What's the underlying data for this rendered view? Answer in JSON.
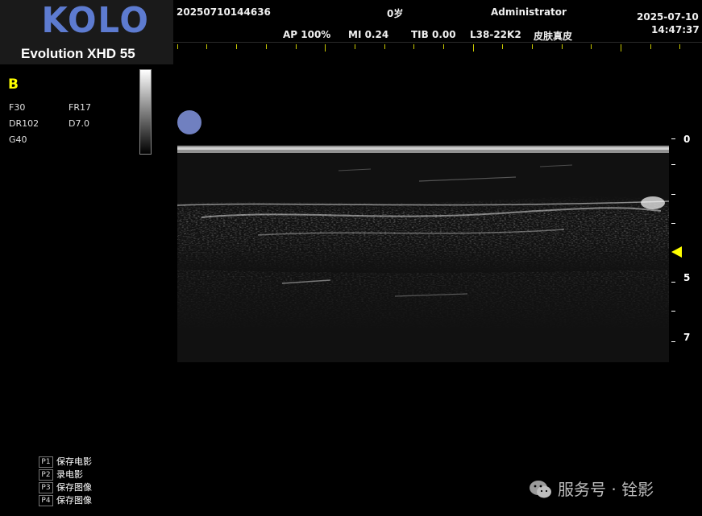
{
  "header": {
    "brand": "KOLO",
    "model": "Evolution XHD 55",
    "patient_id": "20250710144636",
    "age": "0岁",
    "operator": "Administrator",
    "date": "2025-07-10",
    "time": "14:47:37",
    "ap": "AP 100%",
    "mi": "MI 0.24",
    "tib": "TIB 0.00",
    "probe": "L38-22K2",
    "preset": "皮肤真皮"
  },
  "imaging": {
    "mode": "B",
    "params": [
      "F30",
      "FR17",
      "DR102",
      "D7.0",
      "G40"
    ]
  },
  "depth_scale": {
    "labels": [
      "0",
      "5",
      "7"
    ]
  },
  "keys": [
    {
      "key": "P1",
      "label": "保存电影"
    },
    {
      "key": "P2",
      "label": "录电影"
    },
    {
      "key": "P3",
      "label": "保存图像"
    },
    {
      "key": "P4",
      "label": "保存图像"
    }
  ],
  "watermark": "服务号 · 铨影",
  "colors": {
    "brand": "#5d7bd0",
    "mode": "#ffff00",
    "focus_dot": "#7080c0"
  }
}
